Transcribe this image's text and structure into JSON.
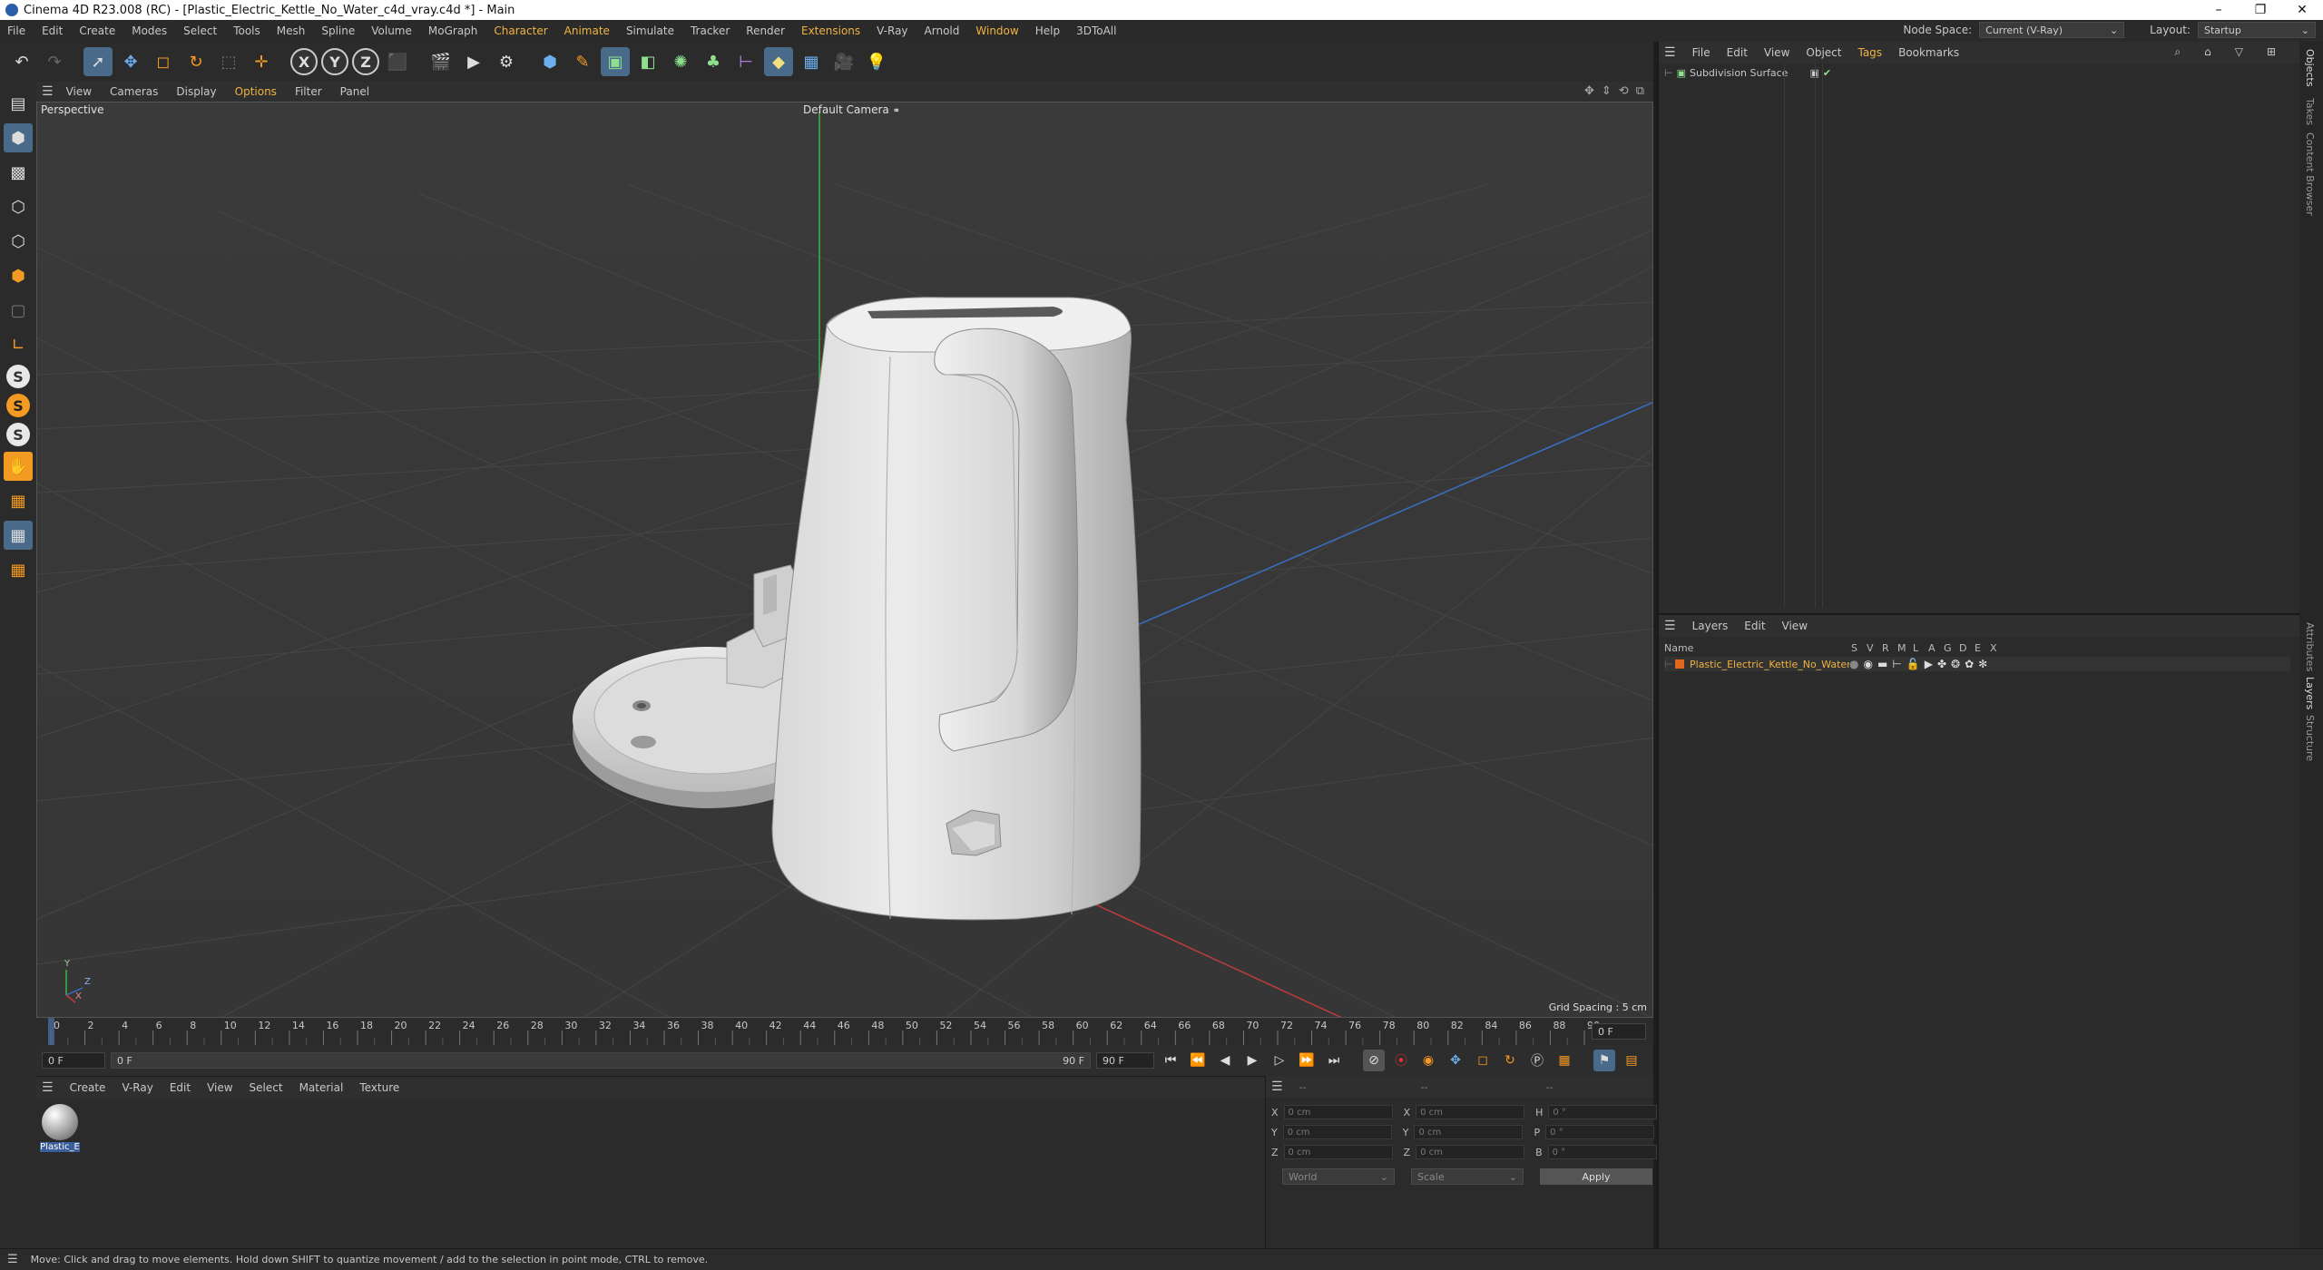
{
  "window": {
    "title": "Cinema 4D R23.008 (RC) - [Plastic_Electric_Kettle_No_Water_c4d_vray.c4d *] - Main",
    "controls": [
      "–",
      "❐",
      "✕"
    ]
  },
  "menubar": {
    "items": [
      "File",
      "Edit",
      "Create",
      "Modes",
      "Select",
      "Tools",
      "Mesh",
      "Spline",
      "Volume",
      "MoGraph",
      "Character",
      "Animate",
      "Simulate",
      "Tracker",
      "Render",
      "Extensions",
      "V-Ray",
      "Arnold",
      "Window",
      "Help",
      "3DToAll"
    ],
    "highlighted": [
      "Character",
      "Animate",
      "Extensions",
      "Window"
    ],
    "node_space_label": "Node Space:",
    "node_space_value": "Current (V-Ray)",
    "layout_label": "Layout:",
    "layout_value": "Startup"
  },
  "viewport": {
    "menu": [
      "View",
      "Cameras",
      "Display",
      "Options",
      "Filter",
      "Panel"
    ],
    "menu_highlighted": "Options",
    "view_name": "Perspective",
    "camera_name": "Default Camera",
    "grid_spacing": "Grid Spacing : 5 cm",
    "axis_labels": {
      "y": "Y",
      "z": "Z",
      "x": "X"
    }
  },
  "timeline": {
    "ticks": [
      "0",
      "2",
      "4",
      "6",
      "8",
      "10",
      "12",
      "14",
      "16",
      "18",
      "20",
      "22",
      "24",
      "26",
      "28",
      "30",
      "32",
      "34",
      "36",
      "38",
      "40",
      "42",
      "44",
      "46",
      "48",
      "50",
      "52",
      "54",
      "56",
      "58",
      "60",
      "62",
      "64",
      "66",
      "68",
      "70",
      "72",
      "74",
      "76",
      "78",
      "80",
      "82",
      "84",
      "86",
      "88",
      "90"
    ],
    "current_frame_field": "0 F"
  },
  "transport": {
    "start_field": "0 F",
    "range_start": "0 F",
    "range_end": "90 F",
    "end_field": "90 F"
  },
  "material_manager": {
    "menu": [
      "Create",
      "V-Ray",
      "Edit",
      "View",
      "Select",
      "Material",
      "Texture"
    ],
    "materials": [
      {
        "name": "Plastic_E"
      }
    ]
  },
  "coordinates": {
    "headers": [
      "--",
      "--",
      "--"
    ],
    "rows": [
      {
        "a": "X",
        "av": "0 cm",
        "b": "X",
        "bv": "0 cm",
        "c": "H",
        "cv": "0 °"
      },
      {
        "a": "Y",
        "av": "0 cm",
        "b": "Y",
        "bv": "0 cm",
        "c": "P",
        "cv": "0 °"
      },
      {
        "a": "Z",
        "av": "0 cm",
        "b": "Z",
        "bv": "0 cm",
        "c": "B",
        "cv": "0 °"
      }
    ],
    "world_dropdown": "World",
    "scale_dropdown": "Scale",
    "apply_label": "Apply"
  },
  "status": {
    "text": "Move: Click and drag to move elements. Hold down SHIFT to quantize movement / add to the selection in point mode, CTRL to remove."
  },
  "object_manager": {
    "menu": [
      "File",
      "Edit",
      "View",
      "Object",
      "Tags",
      "Bookmarks"
    ],
    "menu_highlighted": "Tags",
    "objects": [
      {
        "name": "Subdivision Surface"
      }
    ]
  },
  "layer_manager": {
    "menu": [
      "Layers",
      "Edit",
      "View"
    ],
    "columns": {
      "name": "Name",
      "flags": [
        "S",
        "V",
        "R",
        "M",
        "L",
        "A",
        "G",
        "D",
        "E",
        "X"
      ]
    },
    "layers": [
      {
        "name": "Plastic_Electric_Kettle_No_Water",
        "color": "#e06a1a"
      }
    ]
  },
  "right_tabs": [
    "Objects",
    "Takes",
    "Content Browser",
    "Attributes",
    "Layers",
    "Structure"
  ],
  "colors": {
    "accent": "#f0b340",
    "selection": "#4a6a8a",
    "y_axis": "#3cb34a",
    "x_axis": "#c23b3b",
    "z_axis": "#3a6fc4"
  }
}
